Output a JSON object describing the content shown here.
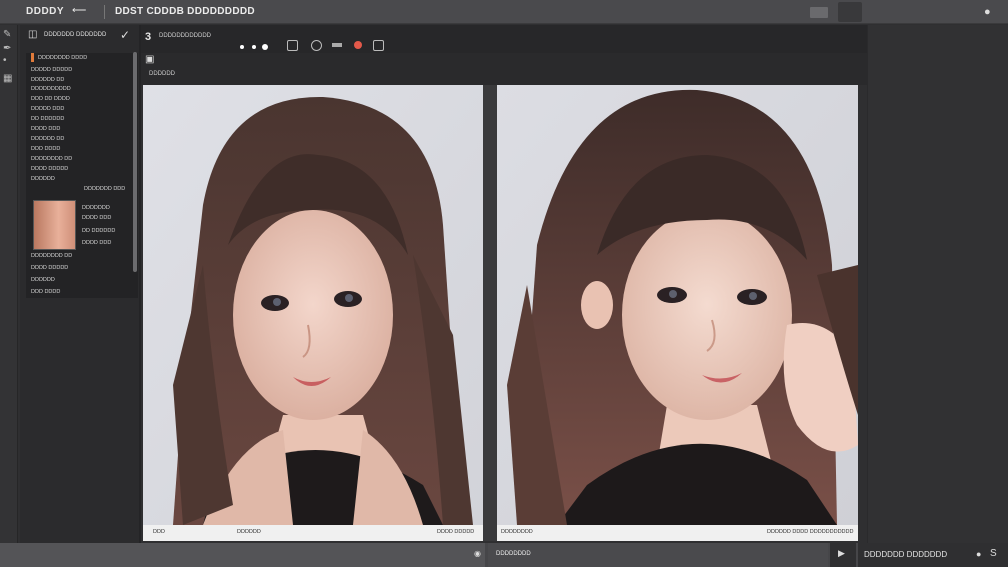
{
  "topbar": {
    "app_name": "DDDDY",
    "arrow": "⟵",
    "doc_title": "DDST CDDDB DDDDDDDDD",
    "message_icon": "chat-bubble-icon"
  },
  "panel": {
    "header_label": "DDDDDDD DDDDDDD",
    "items": [
      "DDDDDDDD DDDD",
      "DDDDD DDDDD",
      "DDDDDD DD",
      "DDDDDDDDDD",
      "DDD DD DDDD",
      "DDDDD DDD",
      "DD DDDDDD",
      "DDDD DDD",
      "DDDDDD DD",
      "DDD DDDD",
      "DDDDDDDD DD",
      "DDDD DDDDD",
      "DDDDDD",
      "DDDDDDD DDD",
      "DDDDDDD",
      "DDDD DDD"
    ]
  },
  "doc": {
    "tab_number": "3",
    "tab_label": "DDDDDDDDDDDD",
    "sub_label": "DDDDDD"
  },
  "captions": {
    "left_a": "DDD",
    "left_b": "DDDDDD",
    "left_c": "DDDD DDDDD",
    "right_a": "DDDDDDDD",
    "right_b": "DDDDDD DDDD DDDDDDDDDDD"
  },
  "status": {
    "seg2_text": "DDDDDDDD",
    "seg4_text": "DDDDDDD DDDDDDD",
    "seg4_num": "S"
  },
  "colors": {
    "accent_orange": "#e07a3a",
    "record_red": "#e3594a",
    "chrome_dark": "#2f2f31",
    "chrome_bar": "#4a4a4d"
  }
}
